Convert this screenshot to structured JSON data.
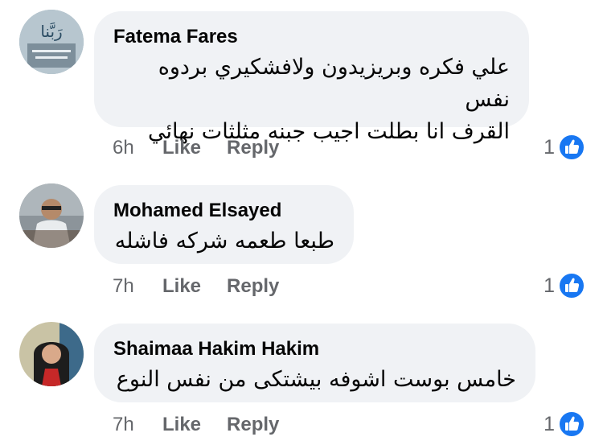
{
  "comments": [
    {
      "author": "Fatema Fares",
      "text_line1": "علي فكره وبريزيدون ولافشكيري بردوه نفس",
      "text_line2": "القرف انا بطلت اجيب جبنه مثلثات نهائي",
      "time": "6h",
      "like_label": "Like",
      "reply_label": "Reply",
      "reaction_count": "1",
      "avatar_text": "رَبَّنا"
    },
    {
      "author": "Mohamed Elsayed",
      "text_line1": "طبعا طعمه شركه فاشله",
      "time": "7h",
      "like_label": "Like",
      "reply_label": "Reply",
      "reaction_count": "1"
    },
    {
      "author": "Shaimaa Hakim Hakim",
      "text_line1": "خامس بوست اشوفه بيشتكى من نفس النوع",
      "time": "7h",
      "like_label": "Like",
      "reply_label": "Reply",
      "reaction_count": "1"
    }
  ],
  "colors": {
    "bubble": "#f0f2f5",
    "secondary_text": "#65676b",
    "like_blue": "#1877f2"
  },
  "icons": [
    "avatar",
    "like-reaction-icon"
  ]
}
